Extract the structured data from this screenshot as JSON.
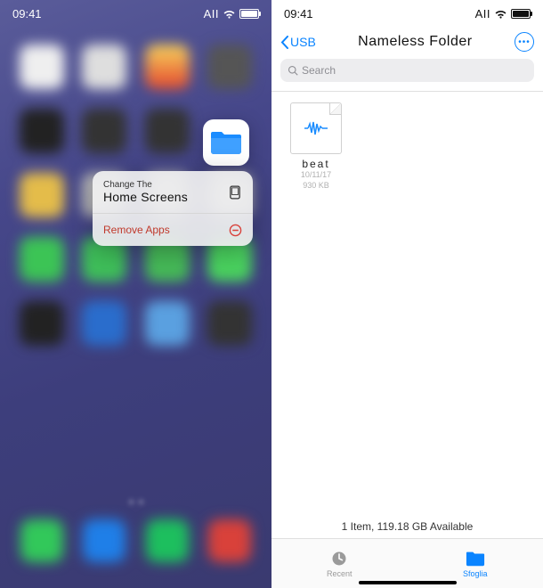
{
  "left": {
    "status": {
      "time": "09:41",
      "carrier": "AII"
    },
    "files_app_icon": "folder-icon",
    "menu": {
      "item1_line1": "Change The",
      "item1_line2": "Home Screens",
      "item2": "Remove Apps"
    }
  },
  "right": {
    "status": {
      "time": "09:41",
      "carrier": "AII"
    },
    "back_label": "USB",
    "title": "Nameless Folder",
    "search_placeholder": "Search",
    "file": {
      "name": "beat",
      "date": "10/11/17",
      "size": "930 KB"
    },
    "footer": "1 Item, 119.18 GB Available",
    "tabs": {
      "recent": "Recent",
      "browse": "Sfoglia"
    }
  }
}
